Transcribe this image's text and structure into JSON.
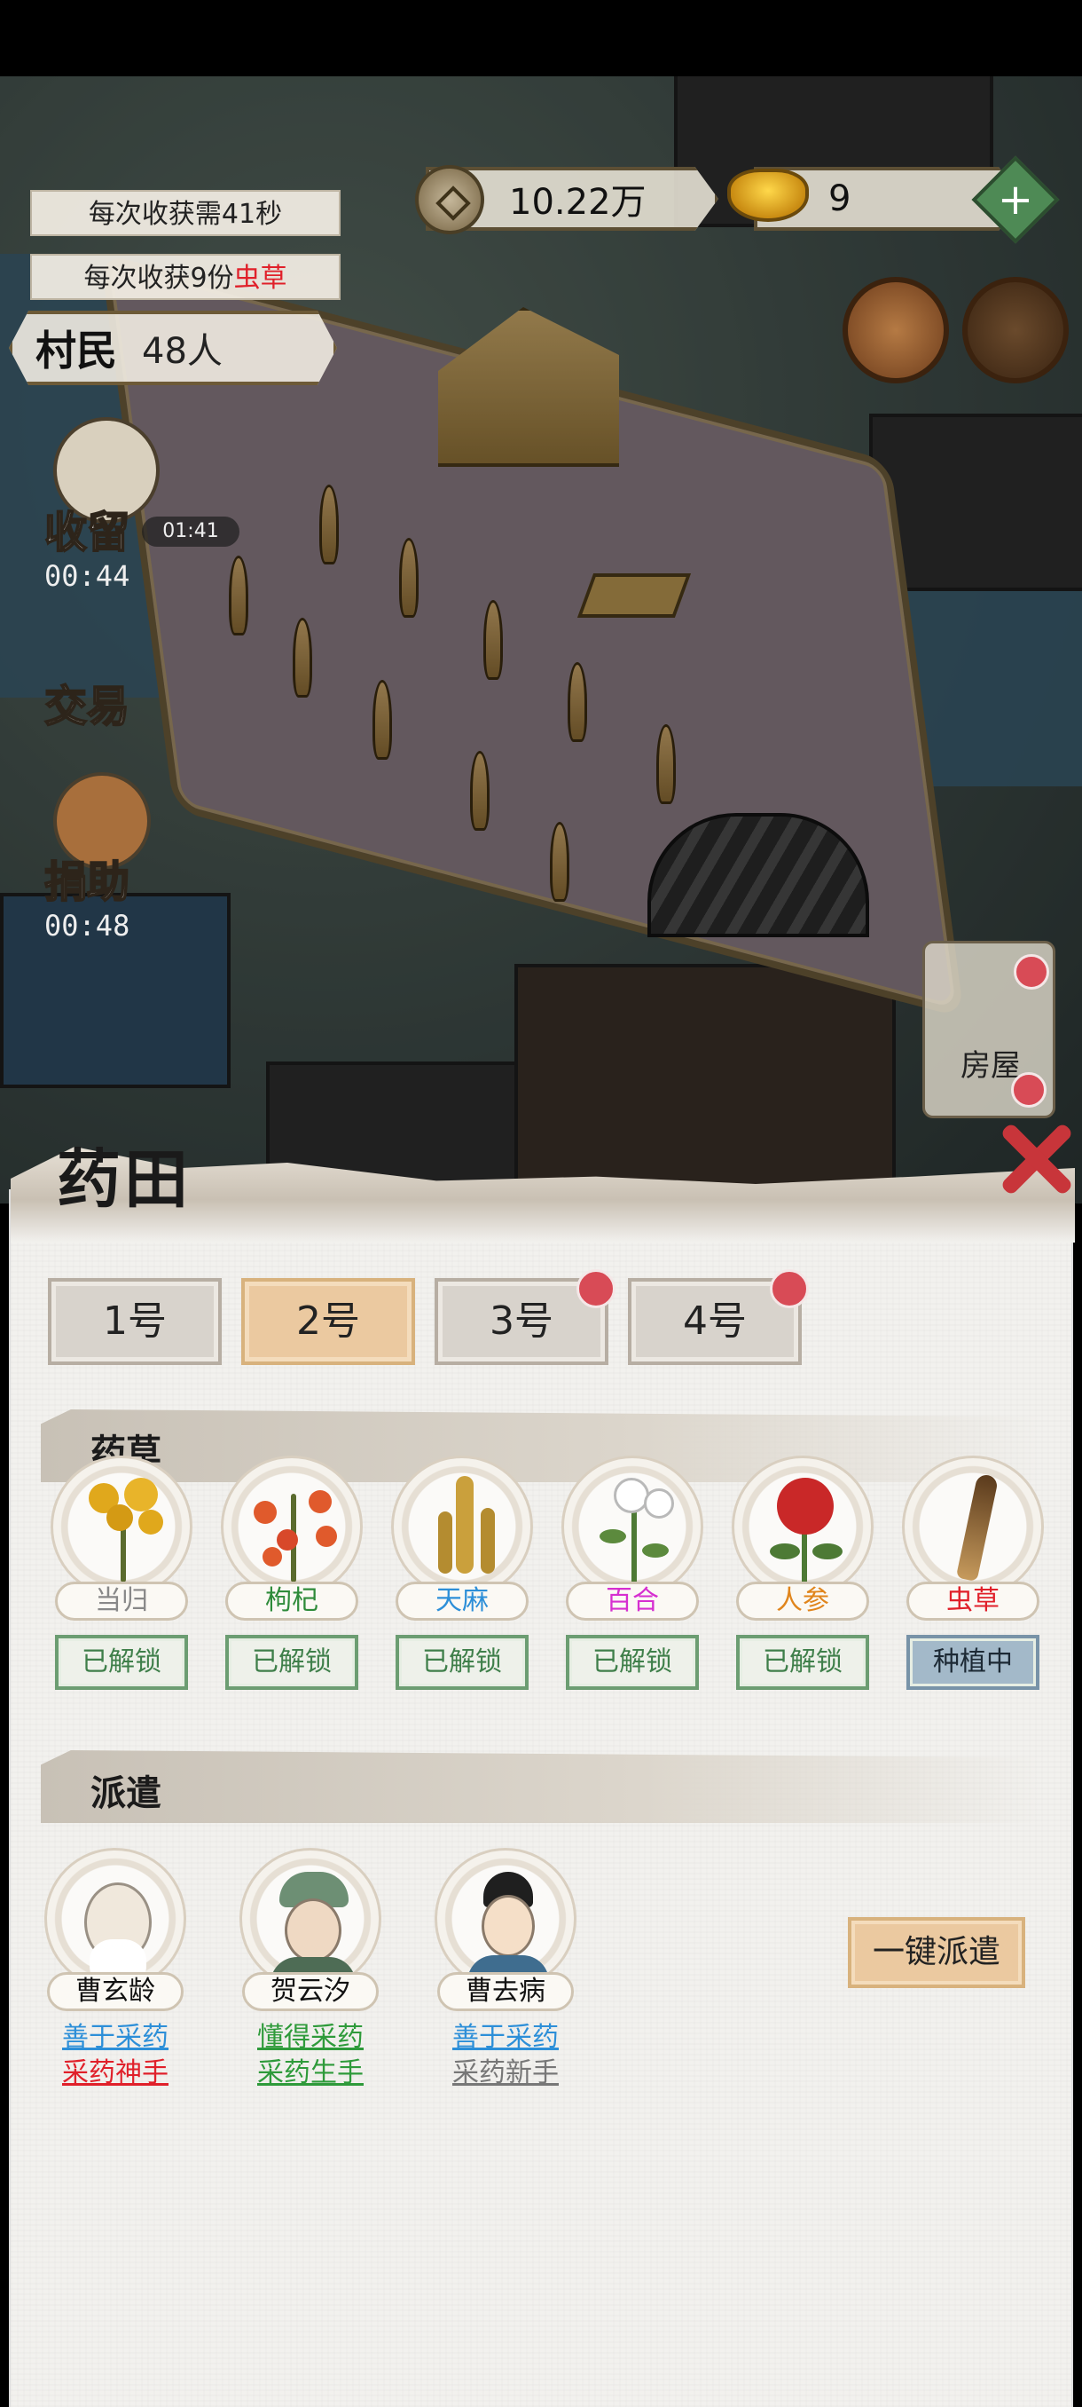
{
  "hud": {
    "harvest_time": "每次收获需41秒",
    "harvest_amount_prefix": "每次收获9份",
    "harvest_amount_item": "虫草",
    "villagers_label": "村民",
    "villagers_value": "48人",
    "coins": "10.22万",
    "ingots": "9"
  },
  "side_menu": {
    "keep": {
      "label": "收留",
      "timer": "00:44",
      "small_timer": "01:41"
    },
    "trade": {
      "label": "交易"
    },
    "donate": {
      "label": "捐助",
      "timer": "00:48"
    },
    "house": {
      "label": "房屋"
    }
  },
  "panel": {
    "title": "药田",
    "tabs": [
      {
        "label": "1号",
        "active": false,
        "dot": false
      },
      {
        "label": "2号",
        "active": true,
        "dot": false
      },
      {
        "label": "3号",
        "active": false,
        "dot": true
      },
      {
        "label": "4号",
        "active": false,
        "dot": true
      }
    ],
    "herbs_section": "药草",
    "herbs": [
      {
        "name": "当归",
        "status": "已解锁",
        "color": "#888888"
      },
      {
        "name": "枸杞",
        "status": "已解锁",
        "color": "#2e8b3a"
      },
      {
        "name": "天麻",
        "status": "已解锁",
        "color": "#2d8fd8"
      },
      {
        "name": "百合",
        "status": "已解锁",
        "color": "#d62fd0"
      },
      {
        "name": "人参",
        "status": "已解锁",
        "color": "#e0851c"
      },
      {
        "name": "虫草",
        "status": "种植中",
        "color": "#e0202a"
      }
    ],
    "dispatch_section": "派遣",
    "workers": [
      {
        "name": "曹玄龄",
        "skill": "善于采药",
        "skill_color": "#2d8fd8",
        "rank": "采药神手",
        "rank_color": "#e0202a"
      },
      {
        "name": "贺云汐",
        "skill": "懂得采药",
        "skill_color": "#2e9a3a",
        "rank": "采药生手",
        "rank_color": "#2e9a3a"
      },
      {
        "name": "曹去病",
        "skill": "善于采药",
        "skill_color": "#2d8fd8",
        "rank": "采药新手",
        "rank_color": "#777777"
      }
    ],
    "dispatch_button": "一键派遣"
  }
}
